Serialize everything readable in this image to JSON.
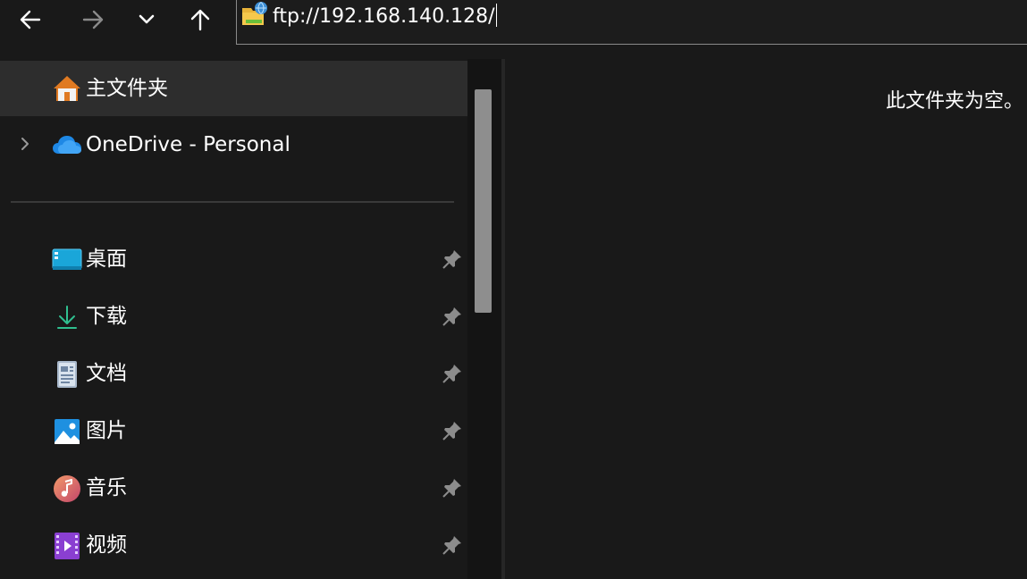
{
  "toolbar": {
    "back_icon": "arrow-left-icon",
    "forward_icon": "arrow-right-icon",
    "recent_icon": "chevron-down-icon",
    "up_icon": "arrow-up-icon"
  },
  "address": {
    "icon": "ftp-folder-icon",
    "path": "ftp://192.168.140.128/"
  },
  "sidebar": {
    "home": {
      "label": "主文件夹",
      "icon": "home-icon"
    },
    "onedrive": {
      "label": "OneDrive - Personal",
      "icon": "onedrive-cloud-icon"
    },
    "quick_access": [
      {
        "label": "桌面",
        "icon": "desktop-icon",
        "pinned": true
      },
      {
        "label": "下载",
        "icon": "download-icon",
        "pinned": true
      },
      {
        "label": "文档",
        "icon": "documents-icon",
        "pinned": true
      },
      {
        "label": "图片",
        "icon": "pictures-icon",
        "pinned": true
      },
      {
        "label": "音乐",
        "icon": "music-icon",
        "pinned": true
      },
      {
        "label": "视频",
        "icon": "videos-icon",
        "pinned": true
      }
    ]
  },
  "content": {
    "empty_message": "此文件夹为空。"
  },
  "colors": {
    "background": "#191919",
    "selected_row": "#2d2d2d",
    "scroll_thumb": "#8e8e8e",
    "address_border": "#8a8a8a"
  }
}
